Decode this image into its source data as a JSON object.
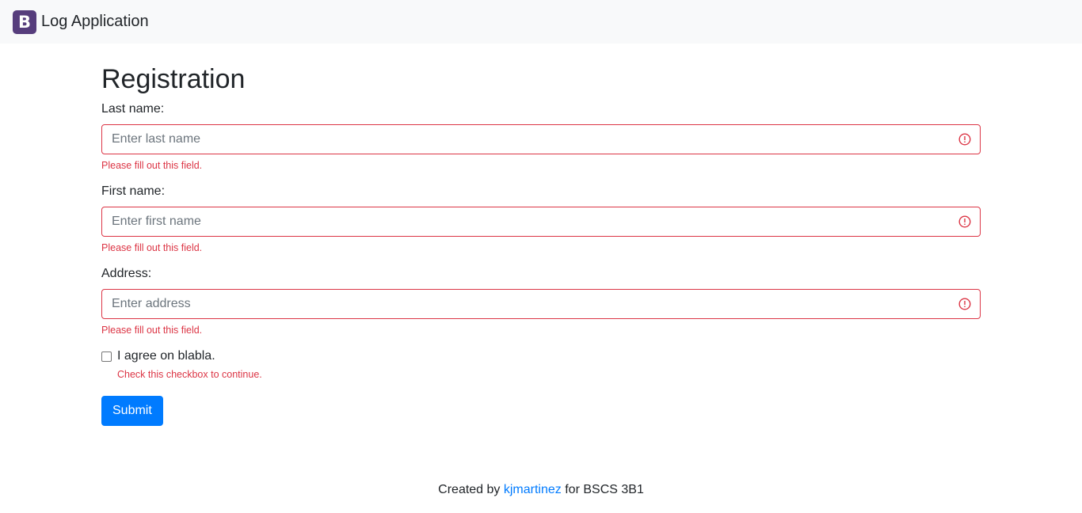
{
  "navbar": {
    "logo_letter": "B",
    "brand": "Log Application",
    "logo_color": "#563d7c"
  },
  "page_title": "Registration",
  "fields": [
    {
      "label": "Last name:",
      "placeholder": "Enter last name",
      "value": "",
      "error": "Please fill out this field."
    },
    {
      "label": "First name:",
      "placeholder": "Enter first name",
      "value": "",
      "error": "Please fill out this field."
    },
    {
      "label": "Address:",
      "placeholder": "Enter address",
      "value": "",
      "error": "Please fill out this field."
    }
  ],
  "agree": {
    "label": "I agree on blabla.",
    "checked": false,
    "error": "Check this checkbox to continue."
  },
  "submit_label": "Submit",
  "footer": {
    "prefix": "Created by",
    "author_link": "kjmartinez",
    "suffix": "for BSCS 3B1"
  },
  "colors": {
    "error": "#dc3545",
    "primary": "#007bff",
    "navbar_bg": "#f8f9fa"
  },
  "icons": {
    "field_error": "exclamation-circle-icon"
  }
}
